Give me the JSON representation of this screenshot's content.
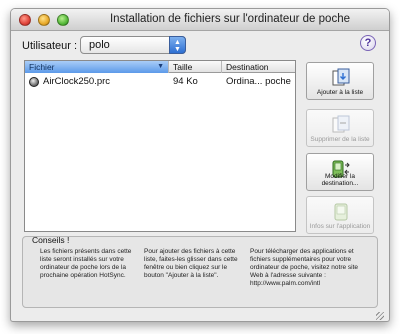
{
  "window": {
    "title": "Installation de fichiers sur l'ordinateur de poche"
  },
  "user": {
    "label": "Utilisateur :",
    "value": "polo"
  },
  "help": {
    "label": "?"
  },
  "table": {
    "columns": [
      "Fichier",
      "Taille",
      "Destination"
    ],
    "rows": [
      {
        "name": "AirClock250.prc",
        "size": "94 Ko",
        "destination": "Ordina... poche"
      }
    ]
  },
  "buttons": {
    "add": "Ajouter à la liste",
    "remove": "Supprimer de la liste",
    "change_destination": "Modifier la destination...",
    "app_info": "Infos sur l'application"
  },
  "tips": {
    "title": "Conseils !",
    "tip1": "Les fichiers présents dans cette liste seront installés sur votre ordinateur de poche lors de la prochaine opération HotSync.",
    "tip2": "Pour ajouter des fichiers à cette liste, faites-les glisser dans cette fenêtre ou bien cliquez sur le bouton \"Ajouter à la liste\".",
    "tip3": "Pour télécharger des applications et fichiers supplémentaires pour votre ordinateur de poche, visitez notre site Web à l'adresse suivante : http://www.palm.com/intl"
  },
  "icons": {
    "add": "add-files-icon",
    "remove": "remove-files-icon",
    "change_destination": "destination-icon",
    "app_info": "app-info-icon",
    "file": "prc-file-icon"
  },
  "colors": {
    "selected_header": "#5c9ae9",
    "accent": "#2d6fd2"
  }
}
